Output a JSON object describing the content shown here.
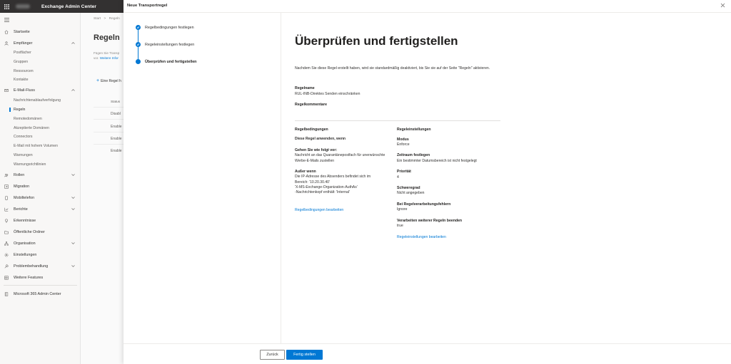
{
  "header": {
    "app_title": "Exchange Admin Center",
    "waffle_icon": "waffle-icon"
  },
  "nav": {
    "items": [
      {
        "label": "Startseite",
        "icon": "home-icon"
      },
      {
        "label": "Empfänger",
        "icon": "person-icon",
        "expanded": true
      },
      {
        "label": "E-Mail-Fluss",
        "icon": "mail-icon",
        "expanded": true
      },
      {
        "label": "Rollen",
        "icon": "roles-icon"
      },
      {
        "label": "Migration",
        "icon": "migration-icon"
      },
      {
        "label": "Mobiltelefon",
        "icon": "mobile-icon"
      },
      {
        "label": "Berichte",
        "icon": "chart-icon"
      },
      {
        "label": "Erkenntnisse",
        "icon": "lightbulb-icon"
      },
      {
        "label": "Öffentliche Ordner",
        "icon": "folder-icon"
      },
      {
        "label": "Organisation",
        "icon": "organization-icon"
      },
      {
        "label": "Einstellungen",
        "icon": "gear-icon"
      },
      {
        "label": "Problembehandlung",
        "icon": "wrench-icon"
      },
      {
        "label": "Weitere Features",
        "icon": "list-icon"
      },
      {
        "label": "Microsoft 365 Admin Center",
        "icon": "office-icon"
      }
    ],
    "recipients_sub": [
      "Postfächer",
      "Gruppen",
      "Ressourcen",
      "Kontakte"
    ],
    "mailflow_sub": [
      "Nachrichtenablaufverfolgung",
      "Regeln",
      "Remotedomänen",
      "Akzeptierte Domänen",
      "Connectors",
      "E-Mail mit hohem Volumen",
      "Warnungen",
      "Warnungsrichtlinien"
    ]
  },
  "background": {
    "breadcrumb": [
      "Start",
      "Regeln"
    ],
    "title": "Regeln",
    "desc_line1": "Fügen Sie Transp",
    "desc_line2": "vor.",
    "desc_link": "Weitere Infor",
    "add_rule": "Eine Regel h",
    "status_header": "Status",
    "rows": [
      "Disabl",
      "Enable",
      "Enable",
      "Enable"
    ]
  },
  "panel": {
    "title": "Neue Transportregel",
    "steps": [
      {
        "label": "Regelbedingungen festlegen",
        "state": "done"
      },
      {
        "label": "Regeleinstellungen festlegen",
        "state": "done"
      },
      {
        "label": "Überprüfen und fertigstellen",
        "state": "current"
      }
    ],
    "heading": "Überprüfen und fertigstellen",
    "intro": "Nachdem Sie diese Regel erstellt haben, wird sie standardmäßig deaktiviert, bis Sie sie auf der Seite \"Regeln\" aktivieren.",
    "rule_name_label": "Regelname",
    "rule_name_value": "RUL-INB-Direktes Senden einschränken",
    "rule_comments_label": "Regelkommentare",
    "conditions": {
      "heading": "Regelbedingungen",
      "apply_label": "Diese Regel anwenden, wenn",
      "do_label": "Gehen Sie wie folgt vor:",
      "do_line1": "Nachricht an das Quarantänepostfach für unerwünschte",
      "do_line2": "Werbe-E-Mails zustellen",
      "except_label": "Außer wenn",
      "except_line1": "Die IP-Adresse des Absenders befindet sich im",
      "except_line2": "Bereich: '10.20.30.40'",
      "except_line3": "'X-MS-Exchange-Organization-AuthAs'",
      "except_line4": "-Nachrichtenkopf enthält: 'Internal'",
      "edit_link": "Regelbedingungen bearbeiten"
    },
    "settings": {
      "heading": "Regeleinstellungen",
      "mode_label": "Modus",
      "mode_value": "Enforce",
      "timeframe_label": "Zeitraum festlegen",
      "timeframe_value": "Ein bestimmter Datumsbereich ist nicht festgelegt",
      "priority_label": "Priorität",
      "priority_value": "4",
      "severity_label": "Schweregrad",
      "severity_value": "Nicht angegeben",
      "errors_label": "Bei Regelverarbeitungsfehlern",
      "errors_value": "Ignore",
      "stop_label": "Verarbeiten weiterer Regeln beenden",
      "stop_value": "true",
      "edit_link": "Regeleinstellungen bearbeiten"
    },
    "back_button": "Zurück",
    "done_button": "Fertig stellen"
  },
  "colors": {
    "accent": "#0078d4",
    "header_bg": "#333131"
  }
}
